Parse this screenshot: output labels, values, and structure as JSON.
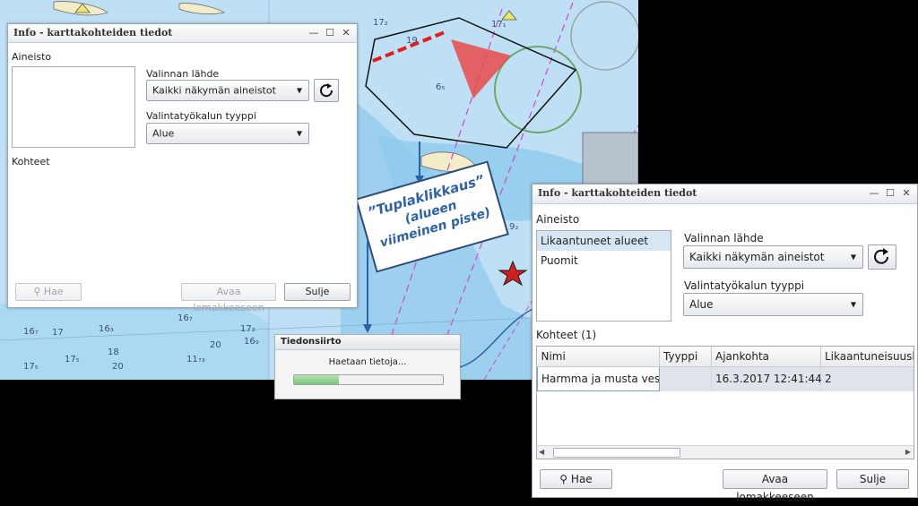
{
  "map": {
    "depth_labels": [
      "17₂",
      "17₁",
      "6₅",
      "19",
      "16₇",
      "17₅",
      "20",
      "16₇",
      "11₇₃",
      "18",
      "17",
      "17₂",
      "16₃",
      "16₉",
      "9₂",
      "17₅",
      "20"
    ]
  },
  "callout": {
    "line1": "”Tuplaklikkaus”",
    "line2": "(alueen",
    "line3": "viimeinen piste)"
  },
  "progress_dialog": {
    "title": "Tiedonsiirto",
    "message": "Haetaan tietoja...",
    "progress": 0.3
  },
  "window_small": {
    "title": "Info - karttakohteiden tiedot",
    "aineisto_label": "Aineisto",
    "valinnan_lahde_label": "Valinnan lähde",
    "valinnan_lahde_value": "Kaikki näkymän aineistot",
    "tyyppi_label": "Valintatyökalun tyyppi",
    "tyyppi_value": "Alue",
    "kohteet_label": "Kohteet",
    "hae": "Hae",
    "avaa": "Avaa lomakkeeseen",
    "sulje": "Sulje"
  },
  "window_large": {
    "title": "Info - karttakohteiden tiedot",
    "aineisto_label": "Aineisto",
    "aineisto_items": [
      "Likaantuneet alueet",
      "Puomit"
    ],
    "valinnan_lahde_label": "Valinnan lähde",
    "valinnan_lahde_value": "Kaikki näkymän aineistot",
    "tyyppi_label": "Valintatyökalun tyyppi",
    "tyyppi_value": "Alue",
    "kohteet_label": "Kohteet",
    "kohteet_count": "(1)",
    "columns": [
      "Nimi",
      "Tyyppi",
      "Ajankohta",
      "Likaantuneisuusluokka"
    ],
    "rows": [
      [
        "Harmma ja musta vesi",
        "",
        "16.3.2017 12:41:44",
        "2"
      ]
    ],
    "hae": "Hae",
    "avaa": "Avaa lomakkeeseen",
    "sulje": "Sulje"
  },
  "colors": {
    "map_water": "#bfe0f4",
    "map_shallow": "#8ec9ec",
    "polygon": "#111111",
    "red_marker": "#e64a4a",
    "callout_text": "#2f62a3",
    "progress_fill": "#8fd08a"
  }
}
